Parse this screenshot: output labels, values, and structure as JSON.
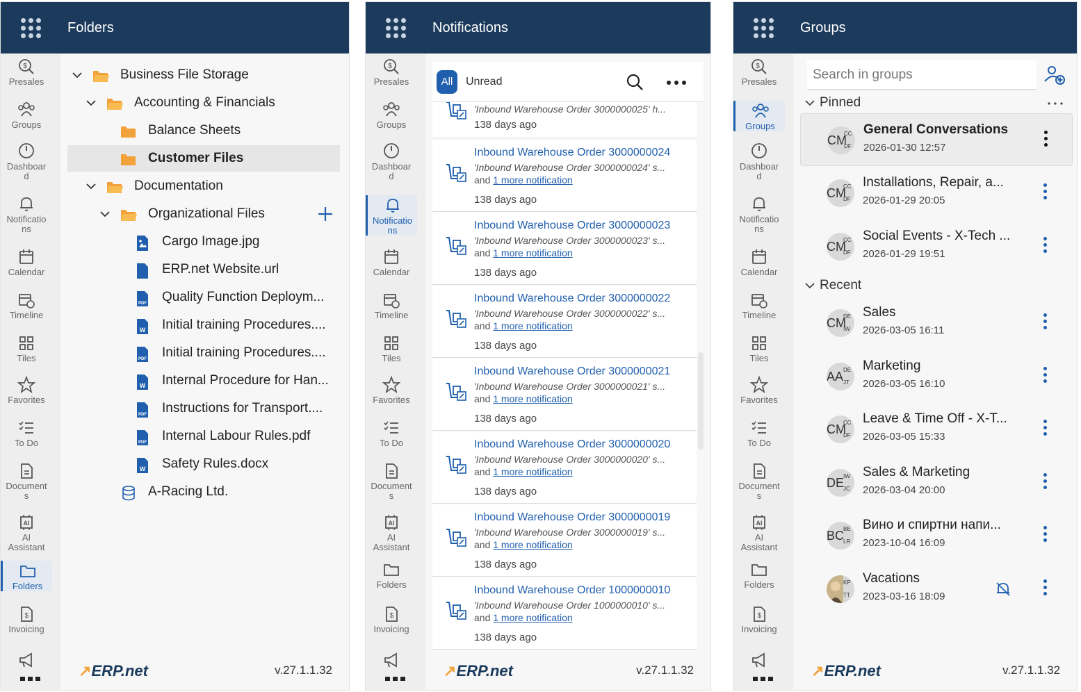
{
  "rail_items": [
    {
      "label": "Presales",
      "icon": "presales-icon"
    },
    {
      "label": "Groups",
      "icon": "groups-icon"
    },
    {
      "label": "Dashboard",
      "icon": "dashboard-icon"
    },
    {
      "label": "Notifications",
      "icon": "bell-icon"
    },
    {
      "label": "Calendar",
      "icon": "calendar-icon"
    },
    {
      "label": "Timeline",
      "icon": "timeline-icon"
    },
    {
      "label": "Tiles",
      "icon": "tiles-icon"
    },
    {
      "label": "Favorites",
      "icon": "star-icon"
    },
    {
      "label": "To Do",
      "icon": "todo-icon"
    },
    {
      "label": "Documents",
      "icon": "document-icon"
    },
    {
      "label": "AI Assistant",
      "icon": "ai-icon"
    },
    {
      "label": "Folders",
      "icon": "folder-icon"
    },
    {
      "label": "Invoicing",
      "icon": "invoice-icon"
    }
  ],
  "rail_lines": {
    "presales": [
      "Presales"
    ],
    "groups": [
      "Groups"
    ],
    "dashboard": [
      "Dashboar",
      "d"
    ],
    "notifications": [
      "Notificatio",
      "ns"
    ],
    "calendar": [
      "Calendar"
    ],
    "timeline": [
      "Timeline"
    ],
    "tiles": [
      "Tiles"
    ],
    "favorites": [
      "Favorites"
    ],
    "todo": [
      "To Do"
    ],
    "documents": [
      "Document",
      "s"
    ],
    "ai": [
      "AI",
      "Assistant"
    ],
    "folders": [
      "Folders"
    ],
    "invoicing": [
      "Invoicing"
    ]
  },
  "footer": {
    "logo": "ERP.net",
    "version": "v.27.1.1.32"
  },
  "folders_panel": {
    "title": "Folders",
    "tree": [
      {
        "label": "Business File Storage",
        "level": 0,
        "type": "folder-open",
        "expanded": true
      },
      {
        "label": "Accounting & Financials",
        "level": 1,
        "type": "folder-open",
        "expanded": true
      },
      {
        "label": "Balance Sheets",
        "level": 2,
        "type": "folder"
      },
      {
        "label": "Customer Files",
        "level": 2,
        "type": "folder",
        "selected": true
      },
      {
        "label": "Documentation",
        "level": 1,
        "type": "folder-open",
        "expanded": true
      },
      {
        "label": "Organizational Files",
        "level": 2,
        "type": "folder-open",
        "expanded": true
      },
      {
        "label": "Cargo Image.jpg",
        "level": 3,
        "type": "image"
      },
      {
        "label": "ERP.net Website.url",
        "level": 3,
        "type": "file"
      },
      {
        "label": "Quality Function Deploym...",
        "level": 3,
        "type": "pdf"
      },
      {
        "label": "Initial training Procedures....",
        "level": 3,
        "type": "word"
      },
      {
        "label": "Initial training Procedures....",
        "level": 3,
        "type": "pdf"
      },
      {
        "label": "Internal Procedure for Han...",
        "level": 3,
        "type": "word"
      },
      {
        "label": "Instructions for Transport....",
        "level": 3,
        "type": "pdf"
      },
      {
        "label": "Internal Labour Rules.pdf",
        "level": 3,
        "type": "pdf"
      },
      {
        "label": "Safety Rules.docx",
        "level": 3,
        "type": "word"
      },
      {
        "label": "A-Racing Ltd.",
        "level": 2,
        "type": "database"
      }
    ]
  },
  "notifications_panel": {
    "title": "Notifications",
    "filter_all": "All",
    "filter_unread": "Unread",
    "more_prefix": "and",
    "more_link": "1 more notification",
    "partial_item": {
      "subtitle": "'Inbound Warehouse Order 3000000025' h...",
      "age": "138 days ago"
    },
    "items": [
      {
        "title": "Inbound Warehouse Order 3000000024",
        "subtitle": "'Inbound Warehouse Order 3000000024' s...",
        "age": "138 days ago"
      },
      {
        "title": "Inbound Warehouse Order 3000000023",
        "subtitle": "'Inbound Warehouse Order 3000000023' s...",
        "age": "138 days ago"
      },
      {
        "title": "Inbound Warehouse Order 3000000022",
        "subtitle": "'Inbound Warehouse Order 3000000022' s...",
        "age": "138 days ago"
      },
      {
        "title": "Inbound Warehouse Order 3000000021",
        "subtitle": "'Inbound Warehouse Order 3000000021' s...",
        "age": "138 days ago"
      },
      {
        "title": "Inbound Warehouse Order 3000000020",
        "subtitle": "'Inbound Warehouse Order 3000000020' s...",
        "age": "138 days ago"
      },
      {
        "title": "Inbound Warehouse Order 3000000019",
        "subtitle": "'Inbound Warehouse Order 3000000019' s...",
        "age": "138 days ago"
      },
      {
        "title": "Inbound Warehouse Order 1000000010",
        "subtitle": "'Inbound Warehouse Order 1000000010' s...",
        "age": "138 days ago"
      }
    ]
  },
  "groups_panel": {
    "title": "Groups",
    "search_placeholder": "Search in groups",
    "pinned_label": "Pinned",
    "recent_label": "Recent",
    "pinned": [
      {
        "name": "General Conversations",
        "date": "2026-01-30 12:57",
        "big": "CM",
        "t1": "CC",
        "t2": "DF",
        "bold": true,
        "highlight": true
      },
      {
        "name": "Installations, Repair, a...",
        "date": "2026-01-29 20:05",
        "big": "CM",
        "t1": "CC",
        "t2": "DF"
      },
      {
        "name": "Social Events - X-Tech ...",
        "date": "2026-01-29 19:51",
        "big": "CM",
        "t1": "CC",
        "t2": "DF"
      }
    ],
    "recent": [
      {
        "name": "Sales",
        "date": "2026-03-05 16:11",
        "big": "CM",
        "t1": "DE",
        "t2": "IW"
      },
      {
        "name": "Marketing",
        "date": "2026-03-05 16:10",
        "big": "AA",
        "t1": "DE",
        "t2": "JT"
      },
      {
        "name": "Leave & Time Off - X-T...",
        "date": "2026-03-05 15:33",
        "big": "CM",
        "t1": "CC",
        "t2": "DF"
      },
      {
        "name": "Sales & Marketing",
        "date": "2026-03-04 20:00",
        "big": "DE",
        "t1": "IW",
        "t2": "JC"
      },
      {
        "name": "Вино и спиртни напи...",
        "date": "2023-10-04 16:09",
        "big": "BC",
        "t1": "BE",
        "t2": "LR"
      },
      {
        "name": "Vacations",
        "date": "2023-03-16 18:09",
        "big": "",
        "t1": "KP",
        "t2": "TT",
        "muted": true
      }
    ]
  },
  "colors": {
    "header": "#1b3a5c",
    "accent": "#1f5fae",
    "folder": "#f2a23a"
  }
}
